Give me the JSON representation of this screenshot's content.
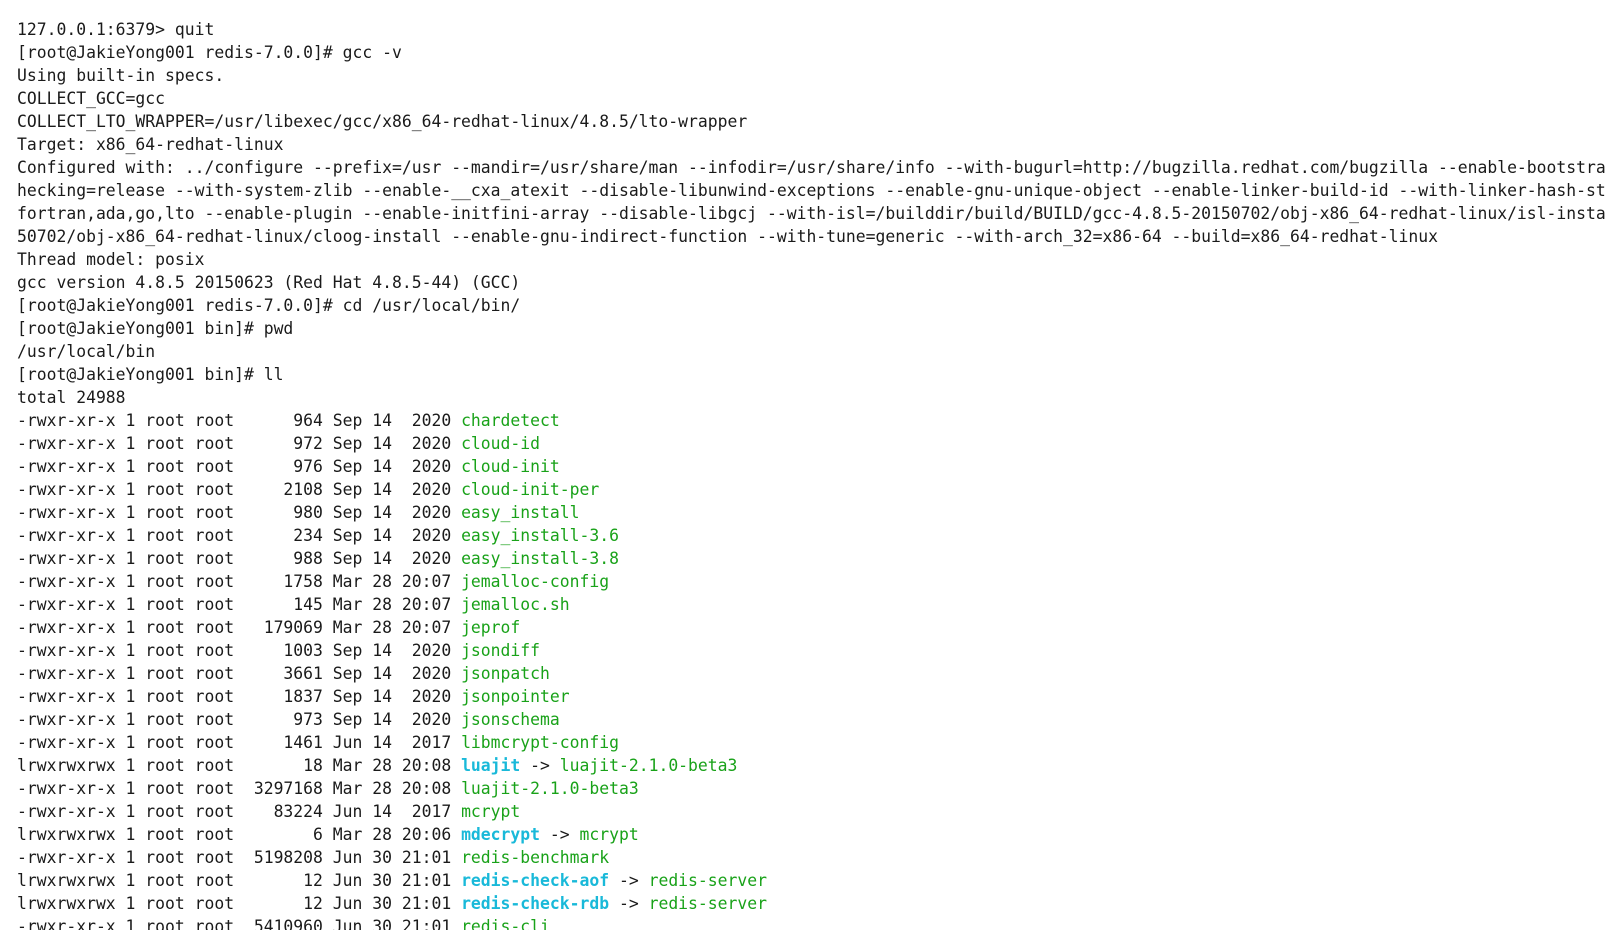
{
  "colors": {
    "background": "#ffffff",
    "text": "#1a1a1a",
    "executable": "#19a219",
    "symlink": "#19b9d9"
  },
  "terminal": {
    "lines": [
      "127.0.0.1:6379> quit",
      "[root@JakieYong001 redis-7.0.0]# gcc -v",
      "Using built-in specs.",
      "COLLECT_GCC=gcc",
      "COLLECT_LTO_WRAPPER=/usr/libexec/gcc/x86_64-redhat-linux/4.8.5/lto-wrapper",
      "Target: x86_64-redhat-linux",
      "Configured with: ../configure --prefix=/usr --mandir=/usr/share/man --infodir=/usr/share/info --with-bugurl=http://bugzilla.redhat.com/bugzilla --enable-bootstra",
      "hecking=release --with-system-zlib --enable-__cxa_atexit --disable-libunwind-exceptions --enable-gnu-unique-object --enable-linker-build-id --with-linker-hash-st",
      "fortran,ada,go,lto --enable-plugin --enable-initfini-array --disable-libgcj --with-isl=/builddir/build/BUILD/gcc-4.8.5-20150702/obj-x86_64-redhat-linux/isl-insta",
      "50702/obj-x86_64-redhat-linux/cloog-install --enable-gnu-indirect-function --with-tune=generic --with-arch_32=x86-64 --build=x86_64-redhat-linux",
      "Thread model: posix",
      "gcc version 4.8.5 20150623 (Red Hat 4.8.5-44) (GCC)",
      "[root@JakieYong001 redis-7.0.0]# cd /usr/local/bin/",
      "[root@JakieYong001 bin]# pwd",
      "/usr/local/bin",
      "[root@JakieYong001 bin]# ll",
      "total 24988"
    ],
    "listing": [
      {
        "meta": "-rwxr-xr-x 1 root root      964 Sep 14  2020 ",
        "name": "chardetect",
        "link": false
      },
      {
        "meta": "-rwxr-xr-x 1 root root      972 Sep 14  2020 ",
        "name": "cloud-id",
        "link": false
      },
      {
        "meta": "-rwxr-xr-x 1 root root      976 Sep 14  2020 ",
        "name": "cloud-init",
        "link": false
      },
      {
        "meta": "-rwxr-xr-x 1 root root     2108 Sep 14  2020 ",
        "name": "cloud-init-per",
        "link": false
      },
      {
        "meta": "-rwxr-xr-x 1 root root      980 Sep 14  2020 ",
        "name": "easy_install",
        "link": false
      },
      {
        "meta": "-rwxr-xr-x 1 root root      234 Sep 14  2020 ",
        "name": "easy_install-3.6",
        "link": false
      },
      {
        "meta": "-rwxr-xr-x 1 root root      988 Sep 14  2020 ",
        "name": "easy_install-3.8",
        "link": false
      },
      {
        "meta": "-rwxr-xr-x 1 root root     1758 Mar 28 20:07 ",
        "name": "jemalloc-config",
        "link": false
      },
      {
        "meta": "-rwxr-xr-x 1 root root      145 Mar 28 20:07 ",
        "name": "jemalloc.sh",
        "link": false
      },
      {
        "meta": "-rwxr-xr-x 1 root root   179069 Mar 28 20:07 ",
        "name": "jeprof",
        "link": false
      },
      {
        "meta": "-rwxr-xr-x 1 root root     1003 Sep 14  2020 ",
        "name": "jsondiff",
        "link": false
      },
      {
        "meta": "-rwxr-xr-x 1 root root     3661 Sep 14  2020 ",
        "name": "jsonpatch",
        "link": false
      },
      {
        "meta": "-rwxr-xr-x 1 root root     1837 Sep 14  2020 ",
        "name": "jsonpointer",
        "link": false
      },
      {
        "meta": "-rwxr-xr-x 1 root root      973 Sep 14  2020 ",
        "name": "jsonschema",
        "link": false
      },
      {
        "meta": "-rwxr-xr-x 1 root root     1461 Jun 14  2017 ",
        "name": "libmcrypt-config",
        "link": false
      },
      {
        "meta": "lrwxrwxrwx 1 root root       18 Mar 28 20:08 ",
        "name": "luajit",
        "link": true,
        "arrow": " -> ",
        "target": "luajit-2.1.0-beta3"
      },
      {
        "meta": "-rwxr-xr-x 1 root root  3297168 Mar 28 20:08 ",
        "name": "luajit-2.1.0-beta3",
        "link": false
      },
      {
        "meta": "-rwxr-xr-x 1 root root    83224 Jun 14  2017 ",
        "name": "mcrypt",
        "link": false
      },
      {
        "meta": "lrwxrwxrwx 1 root root        6 Mar 28 20:06 ",
        "name": "mdecrypt",
        "link": true,
        "arrow": " -> ",
        "target": "mcrypt"
      },
      {
        "meta": "-rwxr-xr-x 1 root root  5198208 Jun 30 21:01 ",
        "name": "redis-benchmark",
        "link": false
      },
      {
        "meta": "lrwxrwxrwx 1 root root       12 Jun 30 21:01 ",
        "name": "redis-check-aof",
        "link": true,
        "arrow": " -> ",
        "target": "redis-server"
      },
      {
        "meta": "lrwxrwxrwx 1 root root       12 Jun 30 21:01 ",
        "name": "redis-check-rdb",
        "link": true,
        "arrow": " -> ",
        "target": "redis-server"
      },
      {
        "meta": "-rwxr-xr-x 1 root root  5410960 Jun 30 21:01 ",
        "name": "redis-cli",
        "link": false
      }
    ]
  }
}
